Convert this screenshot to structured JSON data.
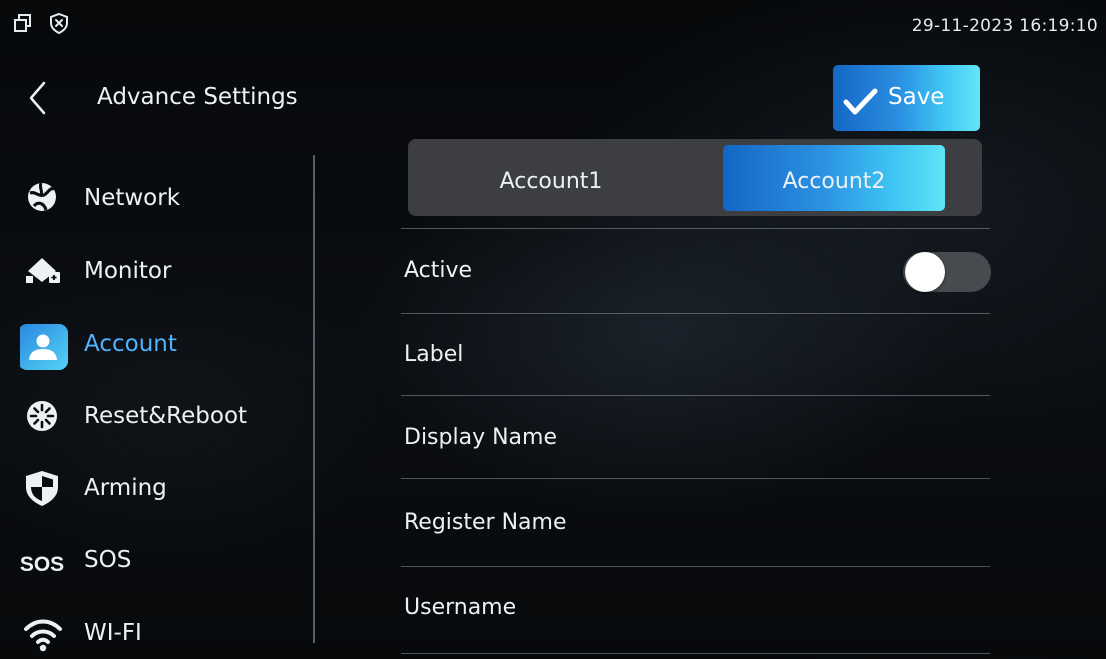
{
  "status_bar": {
    "icons": [
      "window-restore-icon",
      "shield-x-icon"
    ],
    "datetime": "29-11-2023 16:19:10"
  },
  "header": {
    "title": "Advance Settings",
    "back_icon": "chevron-left-icon"
  },
  "toolbar": {
    "save_label": "Save",
    "save_icon": "checkmark-icon"
  },
  "sidebar": {
    "items": [
      {
        "label": "Network",
        "icon": "network-globe-icon",
        "active": false
      },
      {
        "label": "Monitor",
        "icon": "monitor-camera-icon",
        "active": false
      },
      {
        "label": "Account",
        "icon": "user-account-icon",
        "active": true
      },
      {
        "label": "Reset&Reboot",
        "icon": "reset-reboot-icon",
        "active": false
      },
      {
        "label": "Arming",
        "icon": "shield-icon",
        "active": false
      },
      {
        "label": "SOS",
        "icon": "sos-icon",
        "active": false
      },
      {
        "label": "WI-FI",
        "icon": "wifi-icon",
        "active": false
      }
    ]
  },
  "tabs": [
    {
      "label": "Account1",
      "active": false
    },
    {
      "label": "Account2",
      "active": true
    }
  ],
  "fields": [
    {
      "label": "Active",
      "type": "toggle",
      "value": false
    },
    {
      "label": "Label"
    },
    {
      "label": "Display Name"
    },
    {
      "label": "Register Name"
    },
    {
      "label": "Username"
    }
  ],
  "colors": {
    "accent": "#2b92e2",
    "accent_light": "#60e4f5",
    "active_text": "#4fb3ff",
    "tab_bar_bg": "#3c3e42"
  }
}
